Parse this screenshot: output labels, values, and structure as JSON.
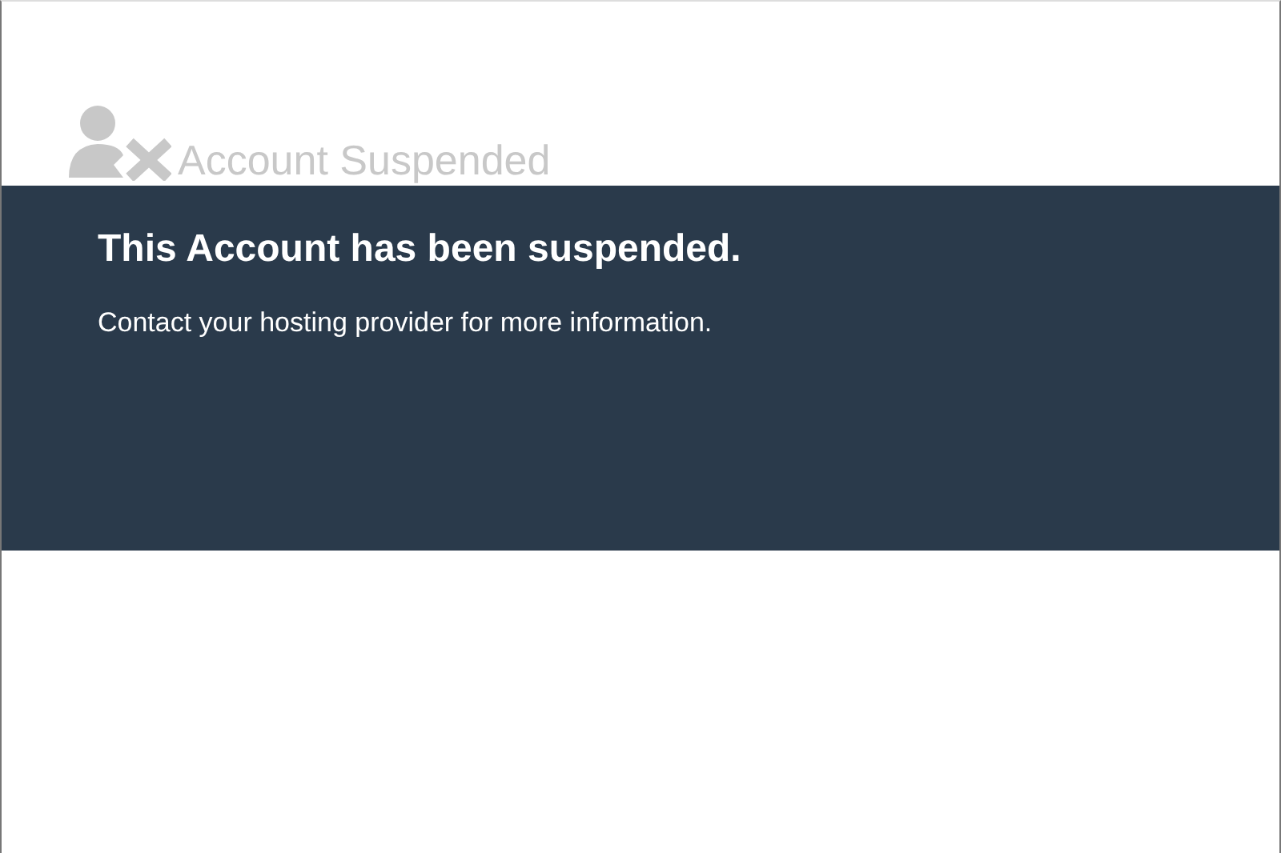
{
  "header": {
    "title": "Account Suspended"
  },
  "banner": {
    "heading": "This Account has been suspended.",
    "message": "Contact your hosting provider for more information."
  }
}
